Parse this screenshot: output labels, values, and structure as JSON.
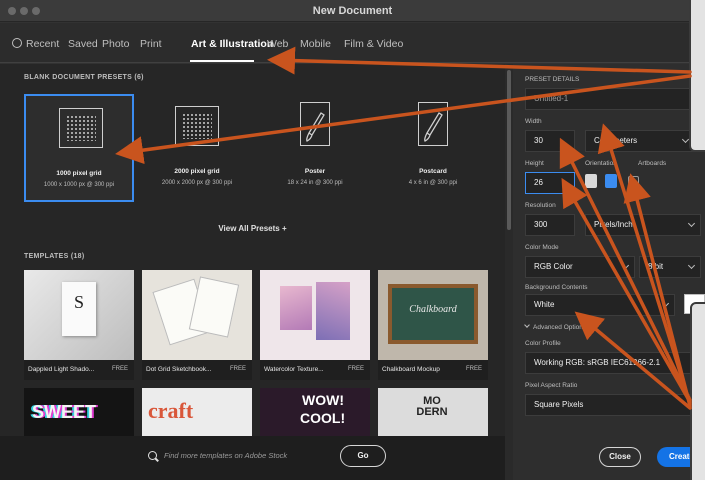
{
  "window": {
    "title": "New Document"
  },
  "tabs": [
    {
      "label": "Recent",
      "icon": "clock-icon"
    },
    {
      "label": "Saved"
    },
    {
      "label": "Photo"
    },
    {
      "label": "Print"
    },
    {
      "label": "Art & Illustration",
      "active": true
    },
    {
      "label": "Web"
    },
    {
      "label": "Mobile"
    },
    {
      "label": "Film & Video"
    }
  ],
  "presets": {
    "title": "BLANK DOCUMENT PRESETS",
    "count": "(6)",
    "items": [
      {
        "name": "1000 pixel grid",
        "desc": "1000 x 1000 px @ 300 ppi",
        "icon": "grid-icon",
        "selected": true
      },
      {
        "name": "2000 pixel grid",
        "desc": "2000 x 2000 px @ 300 ppi",
        "icon": "grid-icon"
      },
      {
        "name": "Poster",
        "desc": "18 x 24 in @ 300 ppi",
        "icon": "brush-icon"
      },
      {
        "name": "Postcard",
        "desc": "4 x 6 in @ 300 ppi",
        "icon": "brush-icon"
      }
    ],
    "view_all": "View All Presets +"
  },
  "templates": {
    "title": "TEMPLATES",
    "count": "(18)",
    "items": [
      {
        "name": "Dappled Light Shado...",
        "badge": "FREE",
        "art_text": "S"
      },
      {
        "name": "Dot Grid Sketchbook...",
        "badge": "FREE"
      },
      {
        "name": "Watercolor Texture...",
        "badge": "FREE"
      },
      {
        "name": "Chalkboard Mockup",
        "badge": "FREE",
        "art_text": "Chalkboard"
      }
    ],
    "row2": [
      {
        "art_text": "SWEET"
      },
      {
        "art_text": "craft"
      },
      {
        "art_text": "COOL!",
        "art_text2": "WOW!"
      },
      {
        "art_text": "MO DERN"
      }
    ]
  },
  "stock": {
    "placeholder": "Find more templates on Adobe Stock",
    "go": "Go"
  },
  "details": {
    "header": "PRESET DETAILS",
    "name": "Untitled-1",
    "width_label": "Width",
    "width": "30",
    "units": "Centimeters",
    "height_label": "Height",
    "height": "26",
    "orientation_label": "Orientation",
    "artboards_label": "Artboards",
    "resolution_label": "Resolution",
    "resolution": "300",
    "resolution_units": "Pixels/Inch",
    "color_mode_label": "Color Mode",
    "color_mode": "RGB Color",
    "bit_depth": "8 bit",
    "bg_label": "Background Contents",
    "bg": "White",
    "advanced": "Advanced Options",
    "profile_label": "Color Profile",
    "profile": "Working RGB: sRGB IEC61966-2.1",
    "aspect_label": "Pixel Aspect Ratio",
    "aspect": "Square Pixels",
    "close": "Close",
    "create": "Create"
  },
  "colors": {
    "accent": "#1473e6",
    "arrow": "#c9541e",
    "panel": "#262626"
  }
}
